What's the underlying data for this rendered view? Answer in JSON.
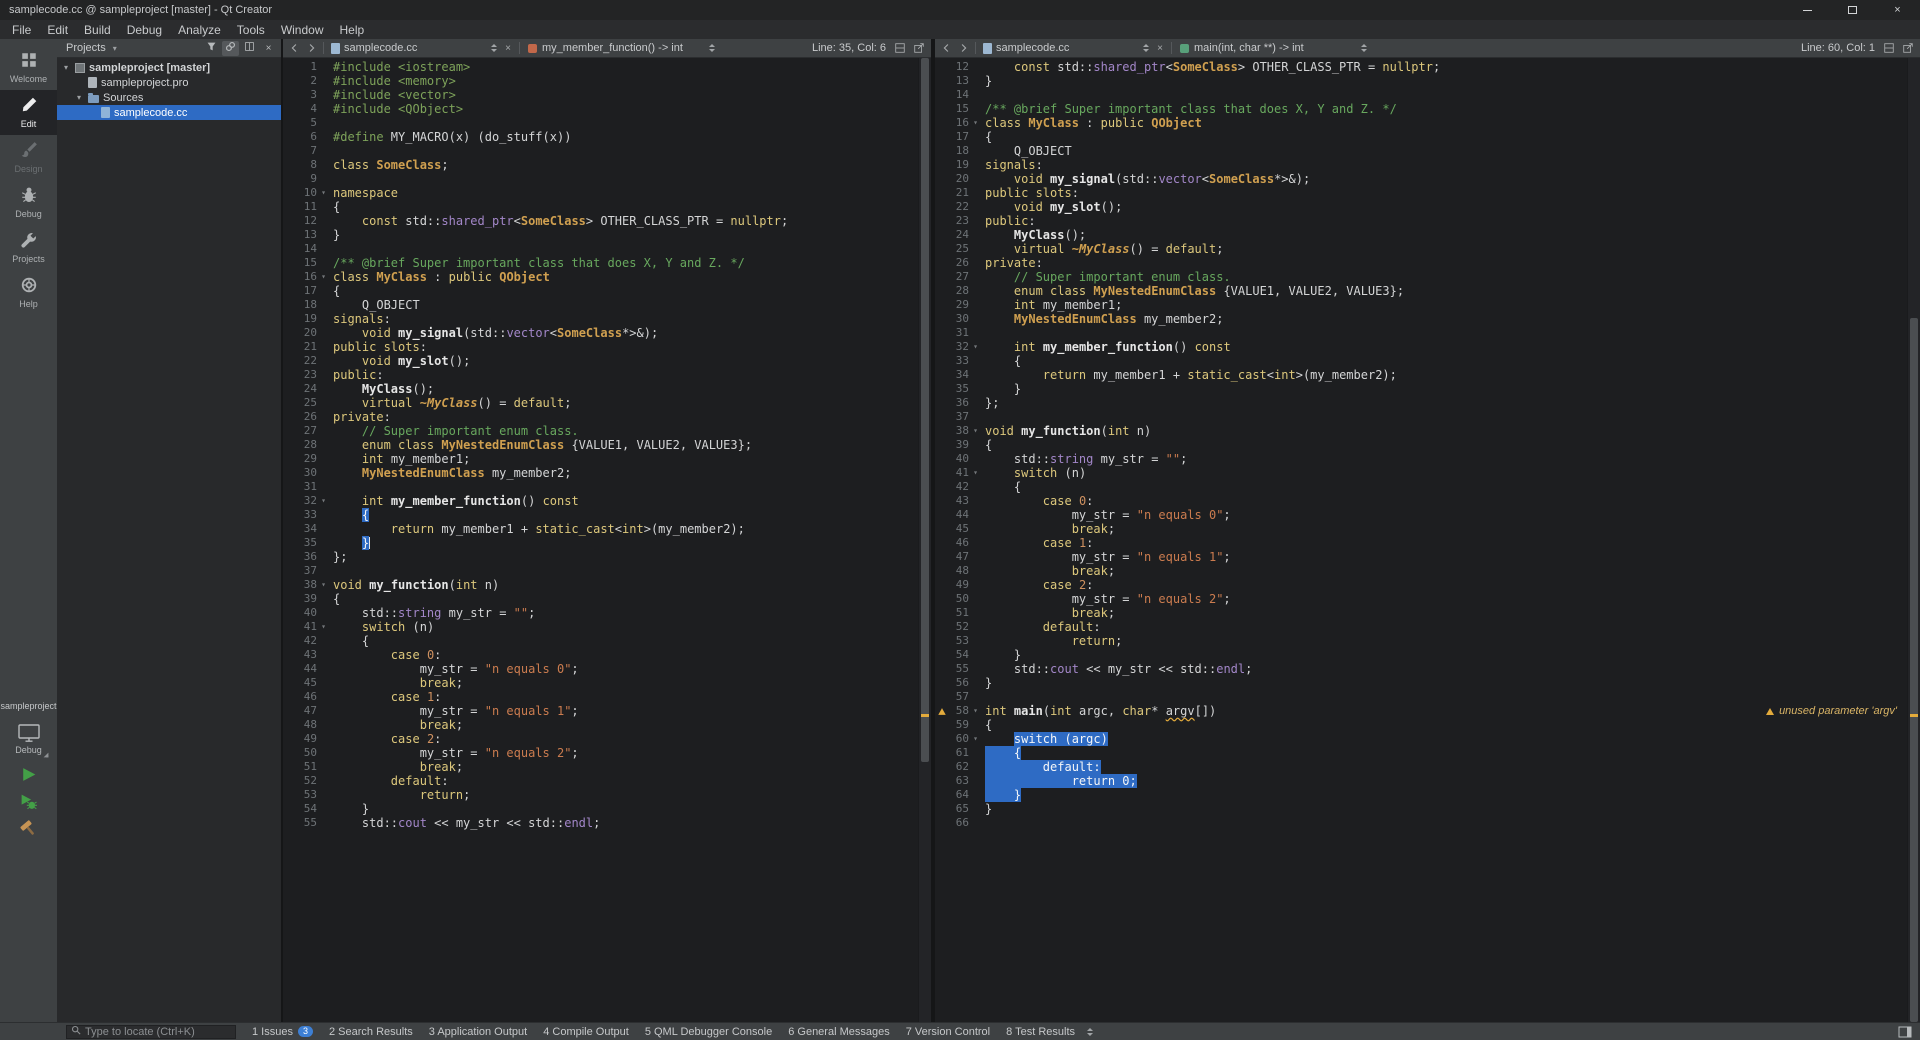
{
  "window": {
    "title": "samplecode.cc @ sampleproject [master] - Qt Creator"
  },
  "menubar": {
    "items": [
      "File",
      "Edit",
      "Build",
      "Debug",
      "Analyze",
      "Tools",
      "Window",
      "Help"
    ]
  },
  "modebar": {
    "modes": [
      {
        "label": "Welcome"
      },
      {
        "label": "Edit",
        "active": true
      },
      {
        "label": "Design",
        "disabled": true
      },
      {
        "label": "Debug"
      },
      {
        "label": "Projects"
      },
      {
        "label": "Help"
      }
    ],
    "project_label": "sampleproject",
    "kit_label": "Debug"
  },
  "sidebar": {
    "header": {
      "title": "Projects"
    },
    "tree": [
      {
        "label": "sampleproject [master]",
        "level": 0,
        "expanded": true,
        "icon": "project",
        "bold": true
      },
      {
        "label": "sampleproject.pro",
        "level": 1,
        "icon": "profile"
      },
      {
        "label": "Sources",
        "level": 1,
        "expanded": true,
        "icon": "folder"
      },
      {
        "label": "samplecode.cc",
        "level": 2,
        "icon": "cppfile",
        "selected": true
      }
    ]
  },
  "editors": {
    "left": {
      "doc": "samplecode.cc",
      "symbol": "my_member_function() -> int",
      "line_col": "Line: 35, Col: 6",
      "symbol_color": "#c2684a",
      "first_line": 1,
      "last_line": 55,
      "overrides": {
        "33": [
          [
            "d",
            "    "
          ],
          [
            "B",
            "{"
          ]
        ],
        "35": [
          [
            "d",
            "    "
          ],
          [
            "B",
            "}"
          ],
          [
            "C",
            ""
          ]
        ]
      },
      "scroll": {
        "thumb_top_pct": 0,
        "thumb_height_pct": 73,
        "mark_pct": 68
      }
    },
    "right": {
      "doc": "samplecode.cc",
      "symbol": "main(int, char **) -> int",
      "line_col": "Line: 60, Col: 1",
      "symbol_color": "#58a07a",
      "first_line": 12,
      "last_line": 66,
      "gutter_warnings": [
        58
      ],
      "annotations": {
        "58": "unused parameter 'argv'"
      },
      "overrides": {
        "58": [
          [
            "k",
            "int"
          ],
          [
            "d",
            " "
          ],
          [
            "f",
            "main"
          ],
          [
            "d",
            "("
          ],
          [
            "k",
            "int"
          ],
          [
            "d",
            " argc, "
          ],
          [
            "k",
            "char"
          ],
          [
            "d",
            "* "
          ],
          [
            "W",
            "argv"
          ],
          [
            "d",
            "[])"
          ]
        ],
        "60": [
          [
            "d",
            "    "
          ],
          [
            "S",
            "switch (argc)"
          ]
        ],
        "61": [
          [
            "S",
            "    {"
          ]
        ],
        "62": [
          [
            "S",
            "        default:"
          ]
        ],
        "63": [
          [
            "S",
            "            return 0;"
          ]
        ],
        "64": [
          [
            "S",
            "    }"
          ]
        ]
      },
      "scroll": {
        "thumb_top_pct": 27,
        "thumb_height_pct": 73,
        "mark_pct": 68
      }
    }
  },
  "file": {
    "fold_lines": [
      10,
      16,
      32,
      38,
      41,
      58,
      60
    ],
    "lines": [
      [
        [
          "p",
          "#include <iostream>"
        ]
      ],
      [
        [
          "p",
          "#include <memory>"
        ]
      ],
      [
        [
          "p",
          "#include <vector>"
        ]
      ],
      [
        [
          "p",
          "#include <QObject>"
        ]
      ],
      [],
      [
        [
          "p",
          "#define"
        ],
        [
          "d",
          " MY_MACRO(x) (do_stuff(x))"
        ]
      ],
      [],
      [
        [
          "k",
          "class"
        ],
        [
          "d",
          " "
        ],
        [
          "t",
          "SomeClass"
        ],
        [
          "d",
          ";"
        ]
      ],
      [],
      [
        [
          "k",
          "namespace"
        ]
      ],
      [
        [
          "d",
          "{"
        ]
      ],
      [
        [
          "d",
          "    "
        ],
        [
          "k",
          "const"
        ],
        [
          "d",
          " std::"
        ],
        [
          "v",
          "shared_ptr"
        ],
        [
          "d",
          "<"
        ],
        [
          "t",
          "SomeClass"
        ],
        [
          "d",
          "> OTHER_CLASS_PTR = "
        ],
        [
          "k",
          "nullptr"
        ],
        [
          "d",
          ";"
        ]
      ],
      [
        [
          "d",
          "}"
        ]
      ],
      [],
      [
        [
          "c",
          "/** @brief Super important class that does X, Y and Z. */"
        ]
      ],
      [
        [
          "k",
          "class"
        ],
        [
          "d",
          " "
        ],
        [
          "t",
          "MyClass"
        ],
        [
          "d",
          " : "
        ],
        [
          "k",
          "public"
        ],
        [
          "d",
          " "
        ],
        [
          "t",
          "QObject"
        ]
      ],
      [
        [
          "d",
          "{"
        ]
      ],
      [
        [
          "d",
          "    Q_OBJECT"
        ]
      ],
      [
        [
          "k",
          "signals"
        ],
        [
          "d",
          ":"
        ]
      ],
      [
        [
          "d",
          "    "
        ],
        [
          "k",
          "void"
        ],
        [
          "d",
          " "
        ],
        [
          "f",
          "my_signal"
        ],
        [
          "d",
          "(std::"
        ],
        [
          "v",
          "vector"
        ],
        [
          "d",
          "<"
        ],
        [
          "t",
          "SomeClass"
        ],
        [
          "d",
          "*>&);"
        ]
      ],
      [
        [
          "k",
          "public slots"
        ],
        [
          "d",
          ":"
        ]
      ],
      [
        [
          "d",
          "    "
        ],
        [
          "k",
          "void"
        ],
        [
          "d",
          " "
        ],
        [
          "f",
          "my_slot"
        ],
        [
          "d",
          "();"
        ]
      ],
      [
        [
          "k",
          "public"
        ],
        [
          "d",
          ":"
        ]
      ],
      [
        [
          "d",
          "    "
        ],
        [
          "f",
          "MyClass"
        ],
        [
          "d",
          "();"
        ]
      ],
      [
        [
          "d",
          "    "
        ],
        [
          "k",
          "virtual"
        ],
        [
          "d",
          " "
        ],
        [
          "i",
          "~MyClass"
        ],
        [
          "d",
          "() = "
        ],
        [
          "k",
          "default"
        ],
        [
          "d",
          ";"
        ]
      ],
      [
        [
          "k",
          "private"
        ],
        [
          "d",
          ":"
        ]
      ],
      [
        [
          "d",
          "    "
        ],
        [
          "c",
          "// Super important enum class."
        ]
      ],
      [
        [
          "d",
          "    "
        ],
        [
          "k",
          "enum class"
        ],
        [
          "d",
          " "
        ],
        [
          "t",
          "MyNestedEnumClass"
        ],
        [
          "d",
          " {VALUE1, VALUE2, VALUE3};"
        ]
      ],
      [
        [
          "d",
          "    "
        ],
        [
          "k",
          "int"
        ],
        [
          "d",
          " my_member1;"
        ]
      ],
      [
        [
          "d",
          "    "
        ],
        [
          "t",
          "MyNestedEnumClass"
        ],
        [
          "d",
          " my_member2;"
        ]
      ],
      [],
      [
        [
          "d",
          "    "
        ],
        [
          "k",
          "int"
        ],
        [
          "d",
          " "
        ],
        [
          "f",
          "my_member_function"
        ],
        [
          "d",
          "() "
        ],
        [
          "k",
          "const"
        ]
      ],
      [
        [
          "d",
          "    {"
        ]
      ],
      [
        [
          "d",
          "        "
        ],
        [
          "k",
          "return"
        ],
        [
          "d",
          " my_member1 + "
        ],
        [
          "k",
          "static_cast"
        ],
        [
          "d",
          "<"
        ],
        [
          "k",
          "int"
        ],
        [
          "d",
          ">(my_member2);"
        ]
      ],
      [
        [
          "d",
          "    }"
        ]
      ],
      [
        [
          "d",
          "};"
        ]
      ],
      [],
      [
        [
          "k",
          "void"
        ],
        [
          "d",
          " "
        ],
        [
          "f",
          "my_function"
        ],
        [
          "d",
          "("
        ],
        [
          "k",
          "int"
        ],
        [
          "d",
          " n)"
        ]
      ],
      [
        [
          "d",
          "{"
        ]
      ],
      [
        [
          "d",
          "    std::"
        ],
        [
          "v",
          "string"
        ],
        [
          "d",
          " my_str = "
        ],
        [
          "s",
          "\"\""
        ],
        [
          "d",
          ";"
        ]
      ],
      [
        [
          "d",
          "    "
        ],
        [
          "k",
          "switch"
        ],
        [
          "d",
          " (n)"
        ]
      ],
      [
        [
          "d",
          "    {"
        ]
      ],
      [
        [
          "d",
          "        "
        ],
        [
          "k",
          "case"
        ],
        [
          "d",
          " "
        ],
        [
          "n",
          "0"
        ],
        [
          "d",
          ":"
        ]
      ],
      [
        [
          "d",
          "            my_str = "
        ],
        [
          "s",
          "\"n equals 0\""
        ],
        [
          "d",
          ";"
        ]
      ],
      [
        [
          "d",
          "            "
        ],
        [
          "k",
          "break"
        ],
        [
          "d",
          ";"
        ]
      ],
      [
        [
          "d",
          "        "
        ],
        [
          "k",
          "case"
        ],
        [
          "d",
          " "
        ],
        [
          "n",
          "1"
        ],
        [
          "d",
          ":"
        ]
      ],
      [
        [
          "d",
          "            my_str = "
        ],
        [
          "s",
          "\"n equals 1\""
        ],
        [
          "d",
          ";"
        ]
      ],
      [
        [
          "d",
          "            "
        ],
        [
          "k",
          "break"
        ],
        [
          "d",
          ";"
        ]
      ],
      [
        [
          "d",
          "        "
        ],
        [
          "k",
          "case"
        ],
        [
          "d",
          " "
        ],
        [
          "n",
          "2"
        ],
        [
          "d",
          ":"
        ]
      ],
      [
        [
          "d",
          "            my_str = "
        ],
        [
          "s",
          "\"n equals 2\""
        ],
        [
          "d",
          ";"
        ]
      ],
      [
        [
          "d",
          "            "
        ],
        [
          "k",
          "break"
        ],
        [
          "d",
          ";"
        ]
      ],
      [
        [
          "d",
          "        "
        ],
        [
          "k",
          "default"
        ],
        [
          "d",
          ":"
        ]
      ],
      [
        [
          "d",
          "            "
        ],
        [
          "k",
          "return"
        ],
        [
          "d",
          ";"
        ]
      ],
      [
        [
          "d",
          "    }"
        ]
      ],
      [
        [
          "d",
          "    std::"
        ],
        [
          "v",
          "cout"
        ],
        [
          "d",
          " << my_str << std::"
        ],
        [
          "v",
          "endl"
        ],
        [
          "d",
          ";"
        ]
      ],
      [
        [
          "d",
          "}"
        ]
      ],
      [],
      [
        [
          "k",
          "int"
        ],
        [
          "d",
          " "
        ],
        [
          "f",
          "main"
        ],
        [
          "d",
          "("
        ],
        [
          "k",
          "int"
        ],
        [
          "d",
          " argc, "
        ],
        [
          "k",
          "char"
        ],
        [
          "d",
          "* argv[])"
        ]
      ],
      [
        [
          "d",
          "{"
        ]
      ],
      [
        [
          "d",
          "    "
        ],
        [
          "k",
          "switch"
        ],
        [
          "d",
          " (argc)"
        ]
      ],
      [
        [
          "d",
          "    {"
        ]
      ],
      [
        [
          "d",
          "        "
        ],
        [
          "k",
          "default"
        ],
        [
          "d",
          ":"
        ]
      ],
      [
        [
          "d",
          "            "
        ],
        [
          "k",
          "return"
        ],
        [
          "d",
          " "
        ],
        [
          "n",
          "0"
        ],
        [
          "d",
          ";"
        ]
      ],
      [
        [
          "d",
          "    }"
        ]
      ],
      [
        [
          "d",
          "}"
        ]
      ],
      []
    ]
  },
  "statusbar": {
    "locator_placeholder": "Type to locate (Ctrl+K)",
    "panes": [
      "1 Issues",
      "2 Search Results",
      "3 Application Output",
      "4 Compile Output",
      "5 QML Debugger Console",
      "6 General Messages",
      "7 Version Control",
      "8 Test Results"
    ],
    "issues_badge": "3"
  },
  "colors": {
    "kw": "#ddc87c",
    "typ": "#d0a050",
    "str": "#cb7c4f",
    "com": "#68a85e",
    "pp": "#7ea35a",
    "std": "#a387c9",
    "fn": "#e6e6e6",
    "num": "#cf9160",
    "def": "#d4d5d6",
    "lnum": "#6e7377",
    "sel": "#2e6bc4",
    "warn": "#e3ab3c",
    "anno": "#d9b466",
    "badge": "#3d7fd4",
    "run_green": "#43a047",
    "build_orange": "#c79454"
  }
}
